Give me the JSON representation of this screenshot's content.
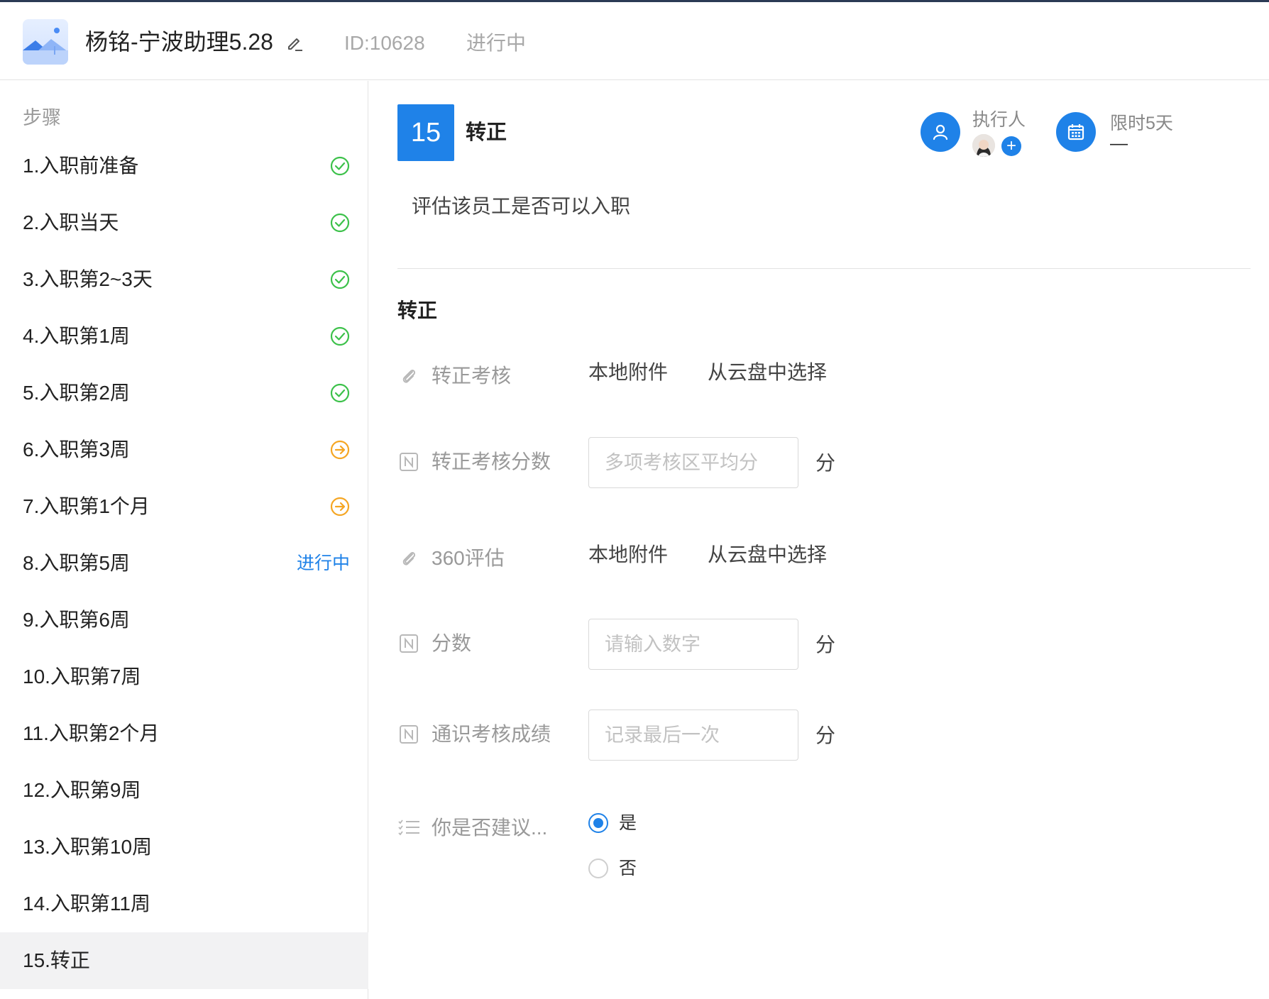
{
  "header": {
    "title": "杨铭-宁波助理5.28",
    "id_text": "ID:10628",
    "status": "进行中"
  },
  "sidebar": {
    "title": "步骤",
    "steps": [
      {
        "label": "1.入职前准备",
        "state": "done"
      },
      {
        "label": "2.入职当天",
        "state": "done"
      },
      {
        "label": "3.入职第2~3天",
        "state": "done"
      },
      {
        "label": "4.入职第1周",
        "state": "done"
      },
      {
        "label": "5.入职第2周",
        "state": "done"
      },
      {
        "label": "6.入职第3周",
        "state": "skipped"
      },
      {
        "label": "7.入职第1个月",
        "state": "skipped"
      },
      {
        "label": "8.入职第5周",
        "state": "in-progress",
        "status_text": "进行中"
      },
      {
        "label": "9.入职第6周",
        "state": "pending"
      },
      {
        "label": "10.入职第7周",
        "state": "pending"
      },
      {
        "label": "11.入职第2个月",
        "state": "pending"
      },
      {
        "label": "12.入职第9周",
        "state": "pending"
      },
      {
        "label": "13.入职第10周",
        "state": "pending"
      },
      {
        "label": "14.入职第11周",
        "state": "pending"
      },
      {
        "label": "15.转正",
        "state": "selected"
      }
    ]
  },
  "main": {
    "step_number": "15",
    "step_title": "转正",
    "executor_label": "执行人",
    "executor_add": "+",
    "time_limit_label": "限时5天",
    "time_limit_value": "—",
    "description": "评估该员工是否可以入职",
    "section_title": "转正",
    "fields": {
      "review_attachment": {
        "label": "转正考核",
        "local": "本地附件",
        "cloud": "从云盘中选择"
      },
      "review_score": {
        "label": "转正考核分数",
        "placeholder": "多项考核区平均分",
        "unit": "分"
      },
      "eval_360": {
        "label": "360评估",
        "local": "本地附件",
        "cloud": "从云盘中选择"
      },
      "score": {
        "label": "分数",
        "placeholder": "请输入数字",
        "unit": "分"
      },
      "general_exam": {
        "label": "通识考核成绩",
        "placeholder": "记录最后一次",
        "unit": "分"
      },
      "recommend": {
        "label": "你是否建议...",
        "options": [
          "是",
          "否"
        ],
        "selected": "是"
      }
    }
  },
  "colors": {
    "accent": "#1f82e8",
    "done": "#3cc14a",
    "skipped": "#f5a623"
  },
  "icons": {
    "edit": "pencil-icon",
    "executor": "user-icon",
    "time_limit": "calendar-icon",
    "attachment": "paperclip-icon",
    "number": "number-field-icon",
    "choice": "checklist-icon",
    "done": "check-circle-icon",
    "skipped": "arrow-right-circle-icon"
  }
}
